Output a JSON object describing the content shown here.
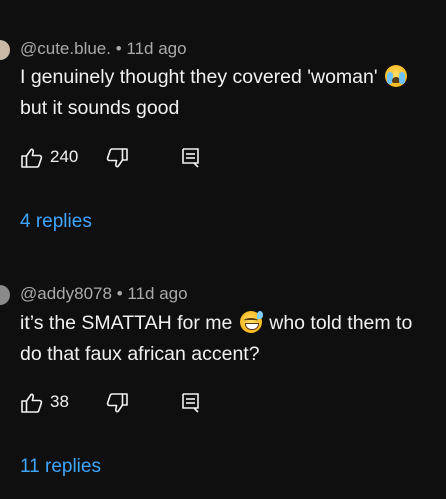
{
  "comments": [
    {
      "author": "@cute.blue.",
      "age": "11d ago",
      "line1": "I genuinely thought they covered 'woman'",
      "line2": "but it sounds good",
      "emoji": "loudly-crying-face",
      "likes": "240",
      "replies_label": "4 replies"
    },
    {
      "author": "@addy8078",
      "age": "11d ago",
      "line1_a": "it’s the SMATTAH for me",
      "line1_b": "who told them to",
      "line2": "do that faux african accent?",
      "emoji": "grinning-face-with-sweat",
      "likes": "38",
      "replies_label": "11 replies"
    }
  ],
  "separator": "•",
  "colors": {
    "background": "#0f0f0f",
    "meta": "#aaaaaa",
    "text": "#f1f1f1",
    "link": "#3ea6ff"
  },
  "icons": [
    "like-icon",
    "dislike-icon",
    "reply-icon"
  ]
}
